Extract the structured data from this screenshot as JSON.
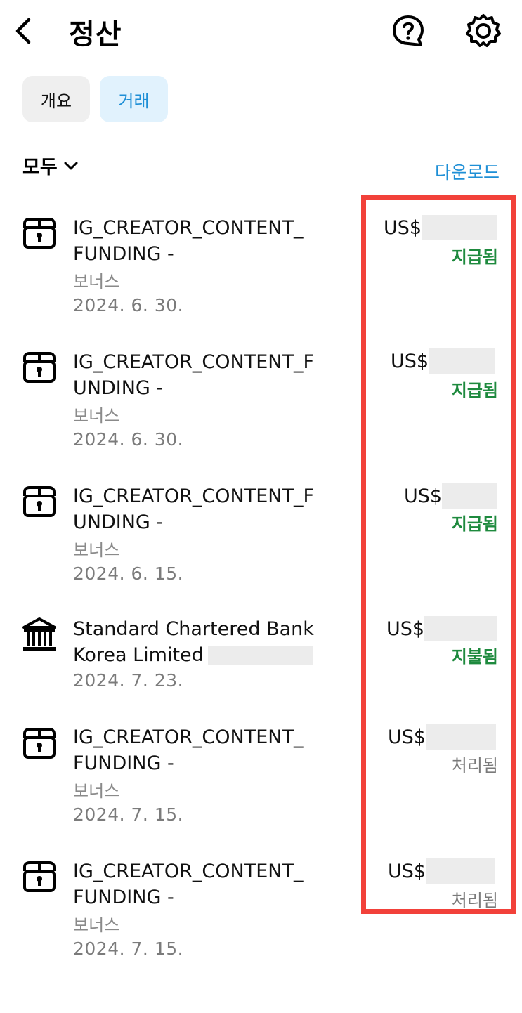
{
  "header": {
    "back_icon": "chevron-left-icon",
    "title": "정산",
    "help_icon": "question-bubble-icon",
    "settings_icon": "gear-icon"
  },
  "tabs": [
    {
      "label": "개요",
      "selected": false
    },
    {
      "label": "거래",
      "selected": true
    }
  ],
  "filter": {
    "label": "모두",
    "icon": "chevron-down-icon"
  },
  "download_label": "다운로드",
  "colors": {
    "accent": "#1e8fd6",
    "paid_green": "#1e8a3e",
    "highlight_red": "#f2413a"
  },
  "transactions": [
    {
      "icon": "gift-box-icon",
      "name_line1": "IG_CREATOR_CONTENT_",
      "name_line2": "FUNDING -",
      "subtitle": "보너스",
      "date": "2024. 6. 30.",
      "currency": "US$",
      "status": "지급됨"
    },
    {
      "icon": "gift-box-icon",
      "name_line1": "IG_CREATOR_CONTENT_F",
      "name_line2": "UNDING -",
      "subtitle": "보너스",
      "date": "2024. 6. 30.",
      "currency": "US$",
      "status": "지급됨"
    },
    {
      "icon": "gift-box-icon",
      "name_line1": "IG_CREATOR_CONTENT_F",
      "name_line2": "UNDING -",
      "subtitle": "보너스",
      "date": "2024. 6. 15.",
      "currency": "US$",
      "status": "지급됨"
    },
    {
      "icon": "bank-icon",
      "name_line1": "Standard Chartered Bank",
      "name_line2": "Korea Limited",
      "subtitle": "",
      "date": "2024. 7. 23.",
      "currency": "US$",
      "status": "지불됨"
    },
    {
      "icon": "gift-box-icon",
      "name_line1": "IG_CREATOR_CONTENT_",
      "name_line2": "FUNDING -",
      "subtitle": "보너스",
      "date": "2024. 7. 15.",
      "currency": "US$",
      "status": "처리됨"
    },
    {
      "icon": "gift-box-icon",
      "name_line1": "IG_CREATOR_CONTENT_",
      "name_line2": "FUNDING -",
      "subtitle": "보너스",
      "date": "2024. 7. 15.",
      "currency": "US$",
      "status": "처리됨"
    }
  ]
}
